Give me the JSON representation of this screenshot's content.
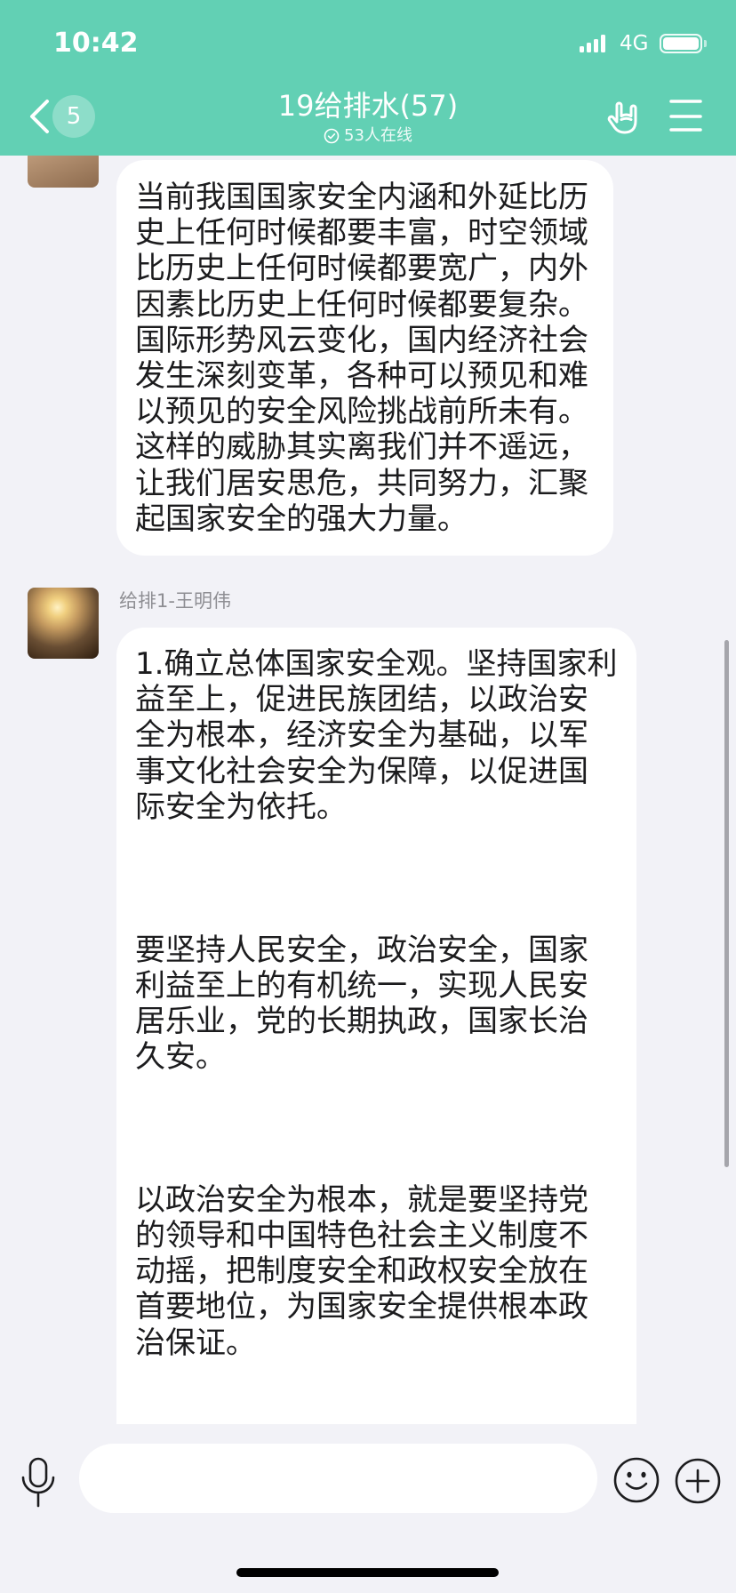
{
  "status_bar": {
    "time": "10:42",
    "network": "4G",
    "icons": [
      "signal-icon",
      "battery-icon"
    ]
  },
  "header": {
    "back_count": "5",
    "title": "19给排水(57)",
    "online_status": "53人在线",
    "icons": {
      "back": "chevron-left-icon",
      "online": "check-circle-icon",
      "gesture": "hand-gesture-icon",
      "menu": "menu-icon"
    }
  },
  "messages": [
    {
      "paragraphs": [
        [
          "当前我国国家安全内涵和外延比历",
          "史上任何时候都要丰富，时空领域",
          "比历史上任何时候都要宽广，内外",
          "因素比历史上任何时候都要复杂。",
          "国际形势风云变化，国内经济社会",
          "发生深刻变革，各种可以预见和难",
          "以预见的安全风险挑战前所未有。",
          "这样的威胁其实离我们并不遥远，",
          "让我们居安思危，共同努力，汇聚",
          "起国家安全的强大力量。"
        ]
      ]
    },
    {
      "sender": "给排1-王明伟",
      "paragraphs": [
        [
          "1.确立总体国家安全观。坚持国家利",
          "益至上，促进民族团结，以政治安",
          "全为根本，经济安全为基础，以军",
          "事文化社会安全为保障，以促进国",
          "际安全为依托。"
        ],
        [
          "要坚持人民安全，政治安全，国家",
          "利益至上的有机统一，实现人民安",
          "居乐业，党的长期执政，国家长治",
          "久安。"
        ],
        [
          "以政治安全为根本，就是要坚持党",
          "的领导和中国特色社会主义制度不",
          "动摇，把制度安全和政权安全放在",
          "首要地位，为国家安全提供根本政",
          "治保证。"
        ]
      ]
    }
  ],
  "composer": {
    "icons": {
      "voice": "mic-icon",
      "emoji": "emoji-icon",
      "more": "plus-icon"
    }
  },
  "colors": {
    "header_bg": "#62d0b4",
    "chat_bg": "#f2f2f7",
    "bubble_bg": "#ffffff",
    "text": "#1c1c1e",
    "sender_name": "#8e8e93"
  }
}
